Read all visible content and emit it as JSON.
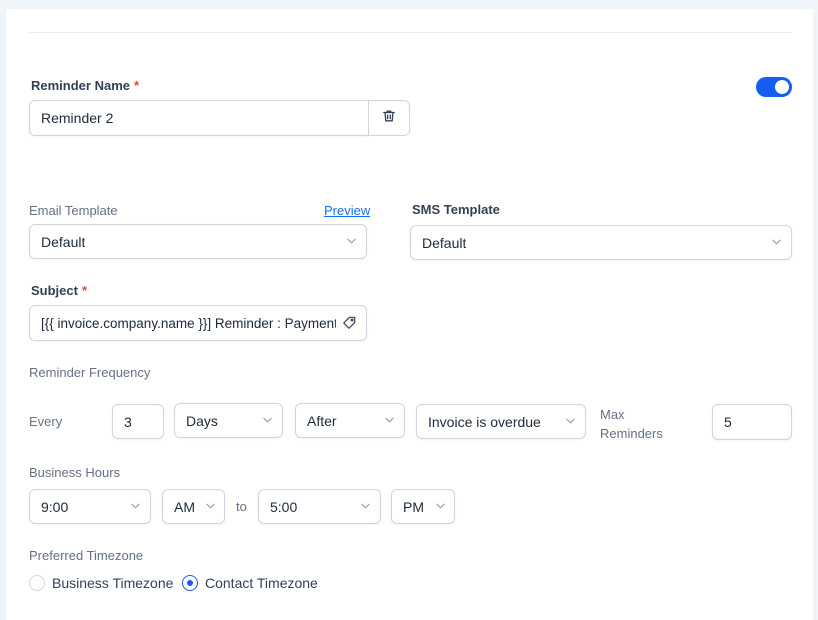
{
  "reminder": {
    "name_label": "Reminder Name",
    "required_mark": "*",
    "name_value": "Reminder 2",
    "enabled": true
  },
  "email_template": {
    "label": "Email Template",
    "preview_link": "Preview",
    "value": "Default"
  },
  "sms_template": {
    "label": "SMS Template",
    "value": "Default"
  },
  "subject": {
    "label": "Subject",
    "value": "[{{ invoice.company.name }}] Reminder : Payment Due"
  },
  "frequency": {
    "label": "Reminder Frequency",
    "every_label": "Every",
    "count": "3",
    "unit": "Days",
    "relation": "After",
    "event": "Invoice is overdue",
    "max_label_line1": "Max",
    "max_label_line2": "Reminders",
    "max_value": "5"
  },
  "business_hours": {
    "label": "Business Hours",
    "start_time": "9:00",
    "start_period": "AM",
    "to_label": "to",
    "end_time": "5:00",
    "end_period": "PM"
  },
  "timezone": {
    "label": "Preferred Timezone",
    "options": [
      "Business Timezone",
      "Contact Timezone"
    ],
    "selected": "Contact Timezone"
  },
  "colors": {
    "accent": "#155eef",
    "required": "#f04438"
  }
}
